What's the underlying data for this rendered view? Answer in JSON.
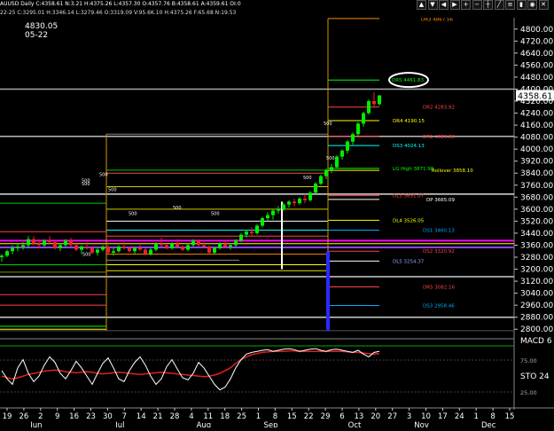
{
  "header": {
    "symbol_line": "AUUSD Daily  C:4358.61  N:3.21  H:4375.26  L:4357.30  O:4357.76  B:4358.61  A:4359.61  OI:0",
    "info_line": "22-25  C:3295.01  H:3346.14  L:3279.46  O:3319.09  V:95.6K.10  H:4375.26  F:65.68  N:19.53",
    "toolbar_icons": [
      "up-arrow-icon",
      "down-arrow-icon",
      "left-arrow-icon",
      "right-arrow-icon",
      "zoom-in-icon",
      "zoom-out-icon",
      "crosshair-icon",
      "draw-icon",
      "list-icon",
      "bars-icon",
      "camera-icon",
      "close-icon"
    ],
    "cursor_value": "4830.05",
    "cursor_date": "05-22"
  },
  "price_axis": {
    "ticks": [
      "4800.00",
      "4720.00",
      "4640.00",
      "4560.00",
      "4480.00",
      "4400.00",
      "4320.00",
      "4240.00",
      "4160.00",
      "4080.00",
      "4000.00",
      "3920.00",
      "3840.00",
      "3760.00",
      "3680.00",
      "3600.00",
      "3520.00",
      "3440.00",
      "3360.00",
      "3280.00",
      "3200.00",
      "3120.00",
      "3040.00",
      "2960.00",
      "2880.00",
      "2800.00"
    ],
    "current_price": "4358.61"
  },
  "indicators": {
    "macd_label": "MACD 6",
    "sto_label": "STO  24",
    "levels": [
      "75.00",
      "25.00"
    ]
  },
  "date_axis": {
    "days": [
      "19",
      "26",
      "2",
      "9",
      "16",
      "23",
      "30",
      "7",
      "14",
      "21",
      "28",
      "4",
      "11",
      "18",
      "25",
      "1",
      "8",
      "15",
      "22",
      "29",
      "6",
      "13",
      "20",
      "27",
      "3",
      "10",
      "17",
      "24",
      "1",
      "8",
      "15"
    ],
    "months": [
      "Jun",
      "Jul",
      "Aug",
      "Sep",
      "Oct",
      "Nov",
      "Dec"
    ]
  },
  "levels": {
    "dr3": "DR3 4867.56",
    "dr5": "DR5 4461.83",
    "dr2": "DR2 4283.92",
    "dr4": "DR4 4190.15",
    "dr1": "DR1 4083.86",
    "ds3": "DS3 4024.13",
    "lg_high": "LG High 3871.98",
    "rollover": "Rollover 3858.10",
    "dl3": "DL3 3691.07",
    "dp": "DP 3665.09",
    "dl4": "DL4 3526.05",
    "ds1": "DS1 3460.13",
    "ds2": "DS2 3320.92",
    "dl5": "DL5 3254.37",
    "dr5b": "DR5 3082.16",
    "ds3b": "DS3 2958.46"
  },
  "markers": {
    "five_hundred": "500"
  },
  "chart_data": {
    "type": "candlestick",
    "title": "AUUSD Daily",
    "ylim": [
      2760,
      4840
    ],
    "ohlc": [
      [
        3280,
        3300,
        3250,
        3290
      ],
      [
        3290,
        3330,
        3280,
        3320
      ],
      [
        3320,
        3360,
        3300,
        3340
      ],
      [
        3340,
        3370,
        3320,
        3350
      ],
      [
        3350,
        3380,
        3330,
        3360
      ],
      [
        3360,
        3420,
        3340,
        3400
      ],
      [
        3400,
        3420,
        3360,
        3370
      ],
      [
        3370,
        3400,
        3340,
        3360
      ],
      [
        3360,
        3400,
        3350,
        3390
      ],
      [
        3390,
        3420,
        3370,
        3380
      ],
      [
        3380,
        3390,
        3330,
        3340
      ],
      [
        3340,
        3370,
        3320,
        3360
      ],
      [
        3360,
        3400,
        3350,
        3390
      ],
      [
        3390,
        3410,
        3350,
        3360
      ],
      [
        3360,
        3370,
        3320,
        3330
      ],
      [
        3330,
        3360,
        3300,
        3350
      ],
      [
        3350,
        3380,
        3330,
        3340
      ],
      [
        3340,
        3350,
        3300,
        3310
      ],
      [
        3310,
        3340,
        3290,
        3330
      ],
      [
        3330,
        3360,
        3320,
        3350
      ],
      [
        3350,
        3360,
        3300,
        3310
      ],
      [
        3310,
        3340,
        3290,
        3320
      ],
      [
        3320,
        3360,
        3310,
        3350
      ],
      [
        3350,
        3380,
        3330,
        3340
      ],
      [
        3340,
        3350,
        3310,
        3320
      ],
      [
        3320,
        3350,
        3300,
        3340
      ],
      [
        3340,
        3370,
        3320,
        3330
      ],
      [
        3330,
        3340,
        3290,
        3300
      ],
      [
        3300,
        3340,
        3290,
        3330
      ],
      [
        3330,
        3380,
        3320,
        3370
      ],
      [
        3370,
        3410,
        3350,
        3360
      ],
      [
        3360,
        3370,
        3330,
        3340
      ],
      [
        3340,
        3380,
        3330,
        3370
      ],
      [
        3370,
        3400,
        3340,
        3350
      ],
      [
        3350,
        3360,
        3320,
        3330
      ],
      [
        3330,
        3370,
        3320,
        3360
      ],
      [
        3360,
        3400,
        3350,
        3390
      ],
      [
        3390,
        3400,
        3350,
        3360
      ],
      [
        3360,
        3380,
        3340,
        3350
      ],
      [
        3350,
        3360,
        3300,
        3310
      ],
      [
        3310,
        3350,
        3300,
        3340
      ],
      [
        3340,
        3380,
        3330,
        3370
      ],
      [
        3370,
        3390,
        3340,
        3350
      ],
      [
        3350,
        3370,
        3330,
        3360
      ],
      [
        3360,
        3400,
        3350,
        3390
      ],
      [
        3390,
        3440,
        3380,
        3430
      ],
      [
        3430,
        3460,
        3410,
        3450
      ],
      [
        3450,
        3480,
        3420,
        3440
      ],
      [
        3440,
        3500,
        3430,
        3490
      ],
      [
        3490,
        3550,
        3480,
        3540
      ],
      [
        3540,
        3580,
        3520,
        3560
      ],
      [
        3560,
        3600,
        3530,
        3590
      ],
      [
        3590,
        3620,
        3570,
        3600
      ],
      [
        3600,
        3640,
        3590,
        3630
      ],
      [
        3630,
        3660,
        3610,
        3650
      ],
      [
        3650,
        3670,
        3620,
        3640
      ],
      [
        3640,
        3680,
        3630,
        3670
      ],
      [
        3670,
        3700,
        3640,
        3660
      ],
      [
        3660,
        3720,
        3650,
        3710
      ],
      [
        3710,
        3780,
        3700,
        3770
      ],
      [
        3770,
        3830,
        3760,
        3820
      ],
      [
        3820,
        3870,
        3800,
        3860
      ],
      [
        3860,
        3900,
        3840,
        3880
      ],
      [
        3880,
        3960,
        3870,
        3950
      ],
      [
        3950,
        4000,
        3930,
        3990
      ],
      [
        3990,
        4060,
        3970,
        4050
      ],
      [
        4050,
        4110,
        4030,
        4100
      ],
      [
        4100,
        4180,
        4090,
        4170
      ],
      [
        4170,
        4250,
        4150,
        4240
      ],
      [
        4240,
        4330,
        4230,
        4320
      ],
      [
        4320,
        4380,
        4280,
        4300
      ],
      [
        4300,
        4360,
        4290,
        4358
      ]
    ]
  }
}
